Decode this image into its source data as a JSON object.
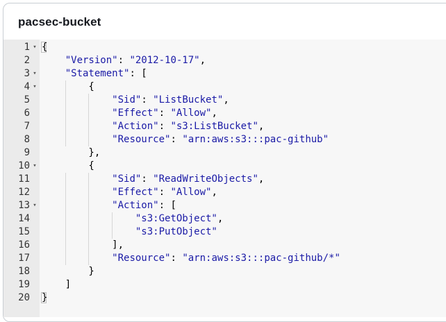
{
  "panel": {
    "title": "pacsec-bucket"
  },
  "editor": {
    "lines": [
      {
        "n": "1",
        "fold": true,
        "tokens": [
          {
            "t": "{",
            "c": "p"
          }
        ]
      },
      {
        "n": "2",
        "fold": false,
        "tokens": [
          {
            "t": "    ",
            "c": "p"
          },
          {
            "t": "\"Version\"",
            "c": "k"
          },
          {
            "t": ": ",
            "c": "p"
          },
          {
            "t": "\"2012-10-17\"",
            "c": "s"
          },
          {
            "t": ",",
            "c": "p"
          }
        ]
      },
      {
        "n": "3",
        "fold": true,
        "tokens": [
          {
            "t": "    ",
            "c": "p"
          },
          {
            "t": "\"Statement\"",
            "c": "k"
          },
          {
            "t": ": [",
            "c": "p"
          }
        ]
      },
      {
        "n": "4",
        "fold": true,
        "tokens": [
          {
            "t": "        {",
            "c": "p"
          }
        ]
      },
      {
        "n": "5",
        "fold": false,
        "tokens": [
          {
            "t": "            ",
            "c": "p"
          },
          {
            "t": "\"Sid\"",
            "c": "k"
          },
          {
            "t": ": ",
            "c": "p"
          },
          {
            "t": "\"ListBucket\"",
            "c": "s"
          },
          {
            "t": ",",
            "c": "p"
          }
        ]
      },
      {
        "n": "6",
        "fold": false,
        "tokens": [
          {
            "t": "            ",
            "c": "p"
          },
          {
            "t": "\"Effect\"",
            "c": "k"
          },
          {
            "t": ": ",
            "c": "p"
          },
          {
            "t": "\"Allow\"",
            "c": "s"
          },
          {
            "t": ",",
            "c": "p"
          }
        ]
      },
      {
        "n": "7",
        "fold": false,
        "tokens": [
          {
            "t": "            ",
            "c": "p"
          },
          {
            "t": "\"Action\"",
            "c": "k"
          },
          {
            "t": ": ",
            "c": "p"
          },
          {
            "t": "\"s3:ListBucket\"",
            "c": "s"
          },
          {
            "t": ",",
            "c": "p"
          }
        ]
      },
      {
        "n": "8",
        "fold": false,
        "tokens": [
          {
            "t": "            ",
            "c": "p"
          },
          {
            "t": "\"Resource\"",
            "c": "k"
          },
          {
            "t": ": ",
            "c": "p"
          },
          {
            "t": "\"arn:aws:s3:::pac-github\"",
            "c": "s"
          }
        ]
      },
      {
        "n": "9",
        "fold": false,
        "tokens": [
          {
            "t": "        },",
            "c": "p"
          }
        ]
      },
      {
        "n": "10",
        "fold": true,
        "tokens": [
          {
            "t": "        {",
            "c": "p"
          }
        ]
      },
      {
        "n": "11",
        "fold": false,
        "tokens": [
          {
            "t": "            ",
            "c": "p"
          },
          {
            "t": "\"Sid\"",
            "c": "k"
          },
          {
            "t": ": ",
            "c": "p"
          },
          {
            "t": "\"ReadWriteObjects\"",
            "c": "s"
          },
          {
            "t": ",",
            "c": "p"
          }
        ]
      },
      {
        "n": "12",
        "fold": false,
        "tokens": [
          {
            "t": "            ",
            "c": "p"
          },
          {
            "t": "\"Effect\"",
            "c": "k"
          },
          {
            "t": ": ",
            "c": "p"
          },
          {
            "t": "\"Allow\"",
            "c": "s"
          },
          {
            "t": ",",
            "c": "p"
          }
        ]
      },
      {
        "n": "13",
        "fold": true,
        "tokens": [
          {
            "t": "            ",
            "c": "p"
          },
          {
            "t": "\"Action\"",
            "c": "k"
          },
          {
            "t": ": [",
            "c": "p"
          }
        ]
      },
      {
        "n": "14",
        "fold": false,
        "tokens": [
          {
            "t": "                ",
            "c": "p"
          },
          {
            "t": "\"s3:GetObject\"",
            "c": "s"
          },
          {
            "t": ",",
            "c": "p"
          }
        ]
      },
      {
        "n": "15",
        "fold": false,
        "tokens": [
          {
            "t": "                ",
            "c": "p"
          },
          {
            "t": "\"s3:PutObject\"",
            "c": "s"
          }
        ]
      },
      {
        "n": "16",
        "fold": false,
        "tokens": [
          {
            "t": "            ],",
            "c": "p"
          }
        ]
      },
      {
        "n": "17",
        "fold": false,
        "tokens": [
          {
            "t": "            ",
            "c": "p"
          },
          {
            "t": "\"Resource\"",
            "c": "k"
          },
          {
            "t": ": ",
            "c": "p"
          },
          {
            "t": "\"arn:aws:s3:::pac-github/*\"",
            "c": "s"
          }
        ]
      },
      {
        "n": "18",
        "fold": false,
        "tokens": [
          {
            "t": "        }",
            "c": "p"
          }
        ]
      },
      {
        "n": "19",
        "fold": false,
        "tokens": [
          {
            "t": "    ]",
            "c": "p"
          }
        ]
      },
      {
        "n": "20",
        "fold": false,
        "tokens": [
          {
            "t": "}",
            "c": "p"
          }
        ]
      }
    ],
    "fold_glyph": "▾",
    "colors": {
      "key": "#1a1aa6",
      "string": "#1a1aa6",
      "punctuation": "#000000",
      "gutter_bg": "#ebebeb",
      "editor_bg": "#f7f7f7"
    }
  }
}
